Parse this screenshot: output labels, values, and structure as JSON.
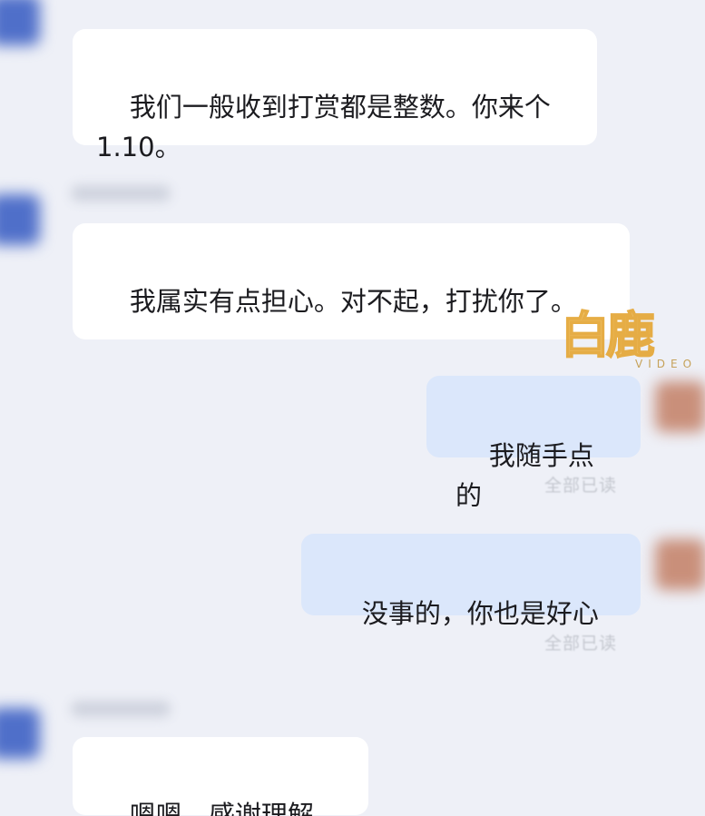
{
  "messages": [
    {
      "direction": "in",
      "text": "我们一般收到打赏都是整数。你来个1.10。"
    },
    {
      "direction": "in",
      "text": "我属实有点担心。对不起，打扰你了。"
    },
    {
      "direction": "out",
      "text": "我随手点的",
      "status": "全部已读"
    },
    {
      "direction": "out",
      "text": "没事的，你也是好心",
      "status": "全部已读"
    },
    {
      "direction": "in",
      "text": "嗯嗯，感谢理解。"
    }
  ],
  "watermark": {
    "logo_text": "白鹿",
    "sub_text": "VIDEO"
  },
  "colors": {
    "background": "#eef0f7",
    "incoming_bubble": "#ffffff",
    "outgoing_bubble": "#dbe7fb",
    "read_status": "#c4c7cf",
    "watermark": "#f0c36a"
  }
}
